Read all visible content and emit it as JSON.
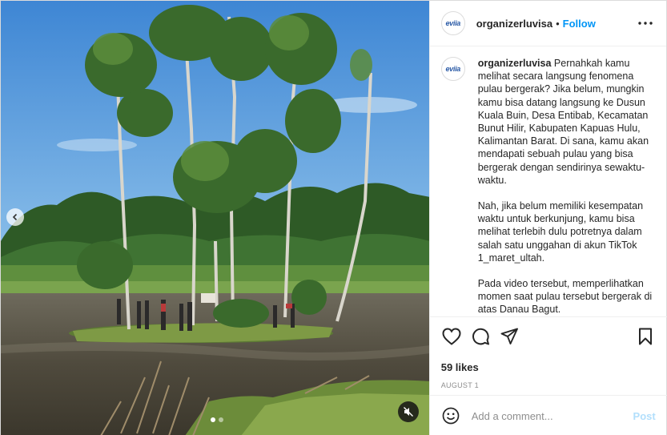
{
  "post": {
    "username": "organizerluvisa",
    "separator": "•",
    "follow_label": "Follow",
    "avatar_logo_text": "eviia",
    "caption": {
      "username": "organizerluvisa",
      "paragraph_1": "Pernahkah kamu melihat secara langsung fenomena pulau bergerak? Jika belum, mungkin kamu bisa datang langsung ke Dusun Kuala Buin, Desa Entibab, Kecamatan Bunut Hilir, Kabupaten Kapuas Hulu, Kalimantan Barat. Di sana, kamu akan mendapati sebuah pulau yang bisa bergerak dengan sendirinya sewaktu-waktu.",
      "paragraph_2": "Nah, jika belum memiliki kesempatan waktu untuk berkunjung, kamu bisa melihat terlebih dulu potretnya dalam salah satu unggahan di akun TikTok 1_maret_ultah.",
      "paragraph_3": "Pada video tersebut, memperlihatkan momen saat pulau tersebut bergerak di atas Danau Bagut."
    },
    "likes": "59 likes",
    "date": "AUGUST 1",
    "comment": {
      "placeholder": "Add a comment...",
      "value": "",
      "post_label": "Post"
    },
    "carousel": {
      "slides": 2,
      "active_index": 0
    },
    "icons": {
      "more": "more-options-icon",
      "like": "heart-icon",
      "comment": "comment-bubble-icon",
      "share": "paper-plane-icon",
      "save": "bookmark-icon",
      "emoji": "smiley-icon",
      "prev": "chevron-left-icon",
      "mute": "speaker-muted-icon"
    },
    "colors": {
      "link": "#0095f6",
      "post_disabled": "#b2dffc",
      "muted_text": "#8e8e8e",
      "text": "#262626"
    }
  }
}
